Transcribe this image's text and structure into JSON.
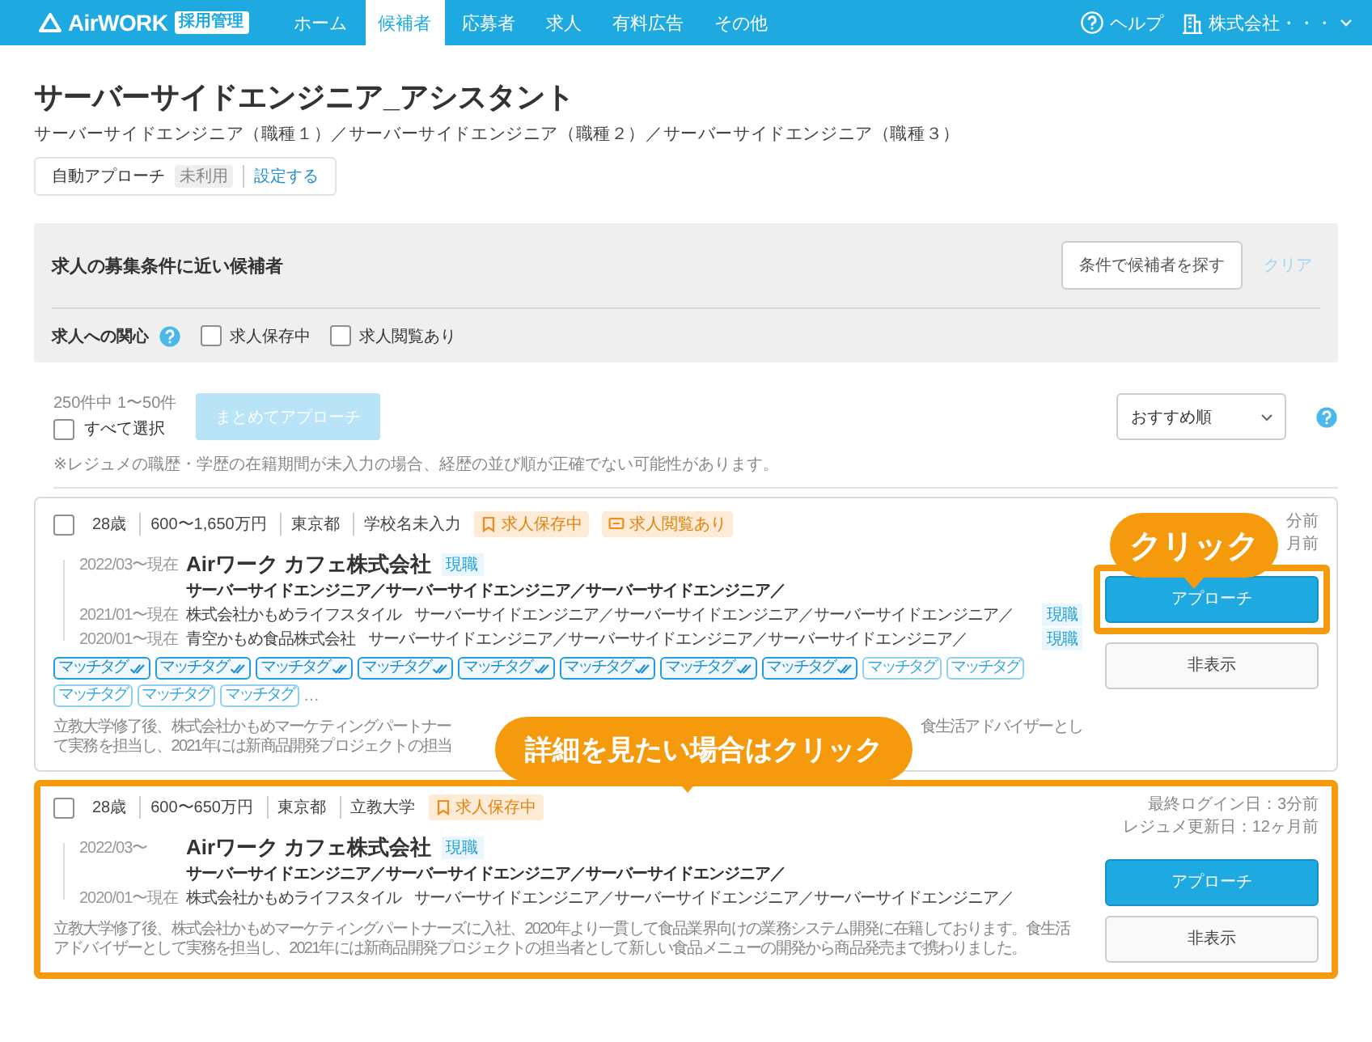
{
  "header": {
    "logo": "AirWORK",
    "logo_badge": "採用管理",
    "nav": [
      {
        "label": "ホーム",
        "selected": false
      },
      {
        "label": "候補者",
        "selected": true
      },
      {
        "label": "応募者",
        "selected": false
      },
      {
        "label": "求人",
        "selected": false
      },
      {
        "label": "有料広告",
        "selected": false
      },
      {
        "label": "その他",
        "selected": false
      }
    ],
    "help": "ヘルプ",
    "account": "株式会社・・・"
  },
  "job": {
    "title": "サーバーサイドエンジニア_アシスタント",
    "subtitle": "サーバーサイドエンジニア（職種１）／サーバーサイドエンジニア（職種２）／サーバーサイドエンジニア（職種３）",
    "auto_approach": {
      "label": "自動アプローチ",
      "status": "未利用",
      "link": "設定する"
    }
  },
  "filter": {
    "title": "求人の募集条件に近い候補者",
    "search_button": "条件で候補者を探す",
    "clear_button": "クリア",
    "interest_label": "求人への関心",
    "options": [
      {
        "label": "求人保存中",
        "checked": false
      },
      {
        "label": "求人閲覧あり",
        "checked": false
      }
    ]
  },
  "list": {
    "count": "250件中 1〜50件",
    "select_all": {
      "label": "すべて選択",
      "checked": false
    },
    "bulk_button": "まとめてアプローチ",
    "sort": "おすすめ順",
    "note": "※レジュメの職歴・学歴の在籍期間が未入力の場合、経歴の並び順が正確でない可能性があります。"
  },
  "candidates": [
    {
      "checked": false,
      "highlighted": false,
      "profile": [
        "28歳",
        "600〜1,650万円",
        "東京都",
        "学校名未入力"
      ],
      "badges": [
        {
          "kind": "saved",
          "label": "求人保存中"
        },
        {
          "kind": "viewed",
          "label": "求人閲覧あり"
        }
      ],
      "last_login": "分前",
      "resume_updated": "月前",
      "career": [
        {
          "period": "2022/03〜現在",
          "company": "Airワーク カフェ株式会社",
          "role": "サーバーサイドエンジニア／サーバーサイドエンジニア／サーバーサイドエンジニア／",
          "current_label": "現職"
        },
        {
          "period": "2021/01〜現在",
          "company": "株式会社かもめライフスタイル",
          "role": "サーバーサイドエンジニア／サーバーサイドエンジニア／サーバーサイドエンジニア／",
          "current_label": "現職"
        },
        {
          "period": "2020/01〜現在",
          "company": "青空かもめ食品株式会社",
          "role": "サーバーサイドエンジニア／サーバーサイドエンジニア／サーバーサイドエンジニア／",
          "current_label": "現職"
        }
      ],
      "tags": [
        {
          "label": "マッチタグ",
          "matched": true
        },
        {
          "label": "マッチタグ",
          "matched": true
        },
        {
          "label": "マッチタグ",
          "matched": true
        },
        {
          "label": "マッチタグ",
          "matched": true
        },
        {
          "label": "マッチタグ",
          "matched": true
        },
        {
          "label": "マッチタグ",
          "matched": true
        },
        {
          "label": "マッチタグ",
          "matched": true
        },
        {
          "label": "マッチタグ",
          "matched": true
        },
        {
          "label": "マッチタグ",
          "matched": false
        },
        {
          "label": "マッチタグ",
          "matched": false
        },
        {
          "label": "マッチタグ",
          "matched": false
        },
        {
          "label": "マッチタグ",
          "matched": false
        },
        {
          "label": "マッチタグ",
          "matched": false
        }
      ],
      "more": "…",
      "bio_lines": [
        {
          "left": "立教大学修了後、株式会社かもめマーケティングパートナー",
          "right": "食生活アドバイザーとし"
        },
        {
          "left": "て実務を担当し、2021年には新商品開発プロジェクトの担当"
        }
      ],
      "approach_button": "アプローチ",
      "approach_highlighted": true,
      "hide_button": "非表示"
    },
    {
      "checked": false,
      "highlighted": true,
      "profile": [
        "28歳",
        "600〜650万円",
        "東京都",
        "立教大学"
      ],
      "badges": [
        {
          "kind": "saved",
          "label": "求人保存中"
        }
      ],
      "last_login": "最終ログイン日：3分前",
      "resume_updated": "レジュメ更新日：12ヶ月前",
      "career": [
        {
          "period": "2022/03〜",
          "company": "Airワーク カフェ株式会社",
          "role": "サーバーサイドエンジニア／サーバーサイドエンジニア／サーバーサイドエンジニア／",
          "current_label": "現職"
        },
        {
          "period": "2020/01〜現在",
          "company": "株式会社かもめライフスタイル",
          "role": "サーバーサイドエンジニア／サーバーサイドエンジニア／サーバーサイドエンジニア／"
        }
      ],
      "bio": "立教大学修了後、株式会社かもめマーケティングパートナーズに入社、2020年より一貫して食品業界向けの業務システム開発に在籍しております。食生活アドバイザーとして実務を担当し、2021年には新商品開発プロジェクトの担当者として新しい食品メニューの開発から商品発売まで携わりました。",
      "approach_button": "アプローチ",
      "approach_highlighted": false,
      "hide_button": "非表示"
    }
  ],
  "callouts": [
    {
      "text": "クリック"
    },
    {
      "text": "詳細を見たい場合はクリック"
    }
  ]
}
